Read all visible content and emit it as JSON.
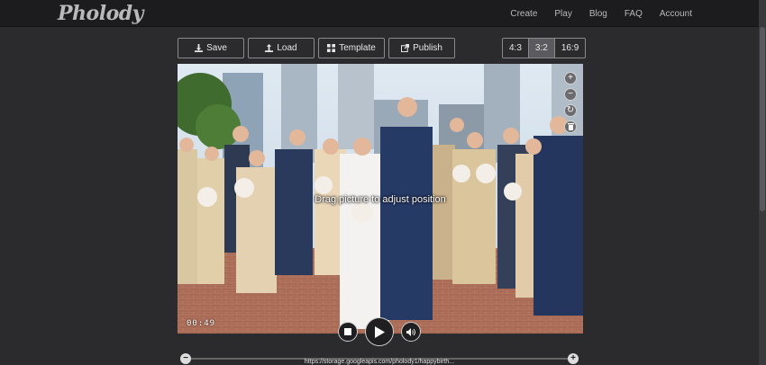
{
  "header": {
    "logo": "Pholody",
    "nav": [
      "Create",
      "Play",
      "Blog",
      "FAQ",
      "Account"
    ]
  },
  "toolbar": {
    "save_label": "Save",
    "load_label": "Load",
    "template_label": "Template",
    "publish_label": "Publish"
  },
  "ratios": {
    "options": [
      "4:3",
      "3:2",
      "16:9"
    ],
    "selected": "3:2"
  },
  "player": {
    "drag_hint": "Drag picture to adjust position",
    "time": "00:49"
  },
  "timeline": {
    "url": "https://storage.googleapis.com/pholody1/happybirth..."
  },
  "colors": {
    "background": "#2b2a2d",
    "topbar": "#1c1b1d",
    "active_ratio": "#5b5a5e"
  }
}
